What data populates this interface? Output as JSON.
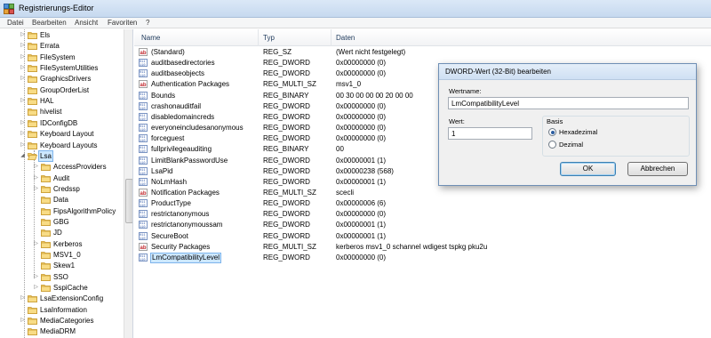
{
  "window": {
    "title": "Registrierungs-Editor"
  },
  "menu": [
    "Datei",
    "Bearbeiten",
    "Ansicht",
    "Favoriten",
    "?"
  ],
  "tree": {
    "items": [
      {
        "label": "Els",
        "depth": 0,
        "expand": "▷"
      },
      {
        "label": "Errata",
        "depth": 0,
        "expand": "▷"
      },
      {
        "label": "FileSystem",
        "depth": 0,
        "expand": "▷"
      },
      {
        "label": "FileSystemUtilities",
        "depth": 0,
        "expand": "▷"
      },
      {
        "label": "GraphicsDrivers",
        "depth": 0,
        "expand": "▷"
      },
      {
        "label": "GroupOrderList",
        "depth": 0,
        "expand": ""
      },
      {
        "label": "HAL",
        "depth": 0,
        "expand": "▷"
      },
      {
        "label": "hivelist",
        "depth": 0,
        "expand": ""
      },
      {
        "label": "IDConfigDB",
        "depth": 0,
        "expand": "▷"
      },
      {
        "label": "Keyboard Layout",
        "depth": 0,
        "expand": "▷"
      },
      {
        "label": "Keyboard Layouts",
        "depth": 0,
        "expand": "▷"
      },
      {
        "label": "Lsa",
        "depth": 0,
        "expand": "◢",
        "selected": true
      },
      {
        "label": "AccessProviders",
        "depth": 1,
        "expand": "▷"
      },
      {
        "label": "Audit",
        "depth": 1,
        "expand": "▷"
      },
      {
        "label": "Credssp",
        "depth": 1,
        "expand": "▷"
      },
      {
        "label": "Data",
        "depth": 1,
        "expand": ""
      },
      {
        "label": "FipsAlgorithmPolicy",
        "depth": 1,
        "expand": ""
      },
      {
        "label": "GBG",
        "depth": 1,
        "expand": ""
      },
      {
        "label": "JD",
        "depth": 1,
        "expand": ""
      },
      {
        "label": "Kerberos",
        "depth": 1,
        "expand": "▷"
      },
      {
        "label": "MSV1_0",
        "depth": 1,
        "expand": ""
      },
      {
        "label": "Skew1",
        "depth": 1,
        "expand": ""
      },
      {
        "label": "SSO",
        "depth": 1,
        "expand": "▷"
      },
      {
        "label": "SspiCache",
        "depth": 1,
        "expand": "▷"
      },
      {
        "label": "LsaExtensionConfig",
        "depth": 0,
        "expand": "▷"
      },
      {
        "label": "LsaInformation",
        "depth": 0,
        "expand": ""
      },
      {
        "label": "MediaCategories",
        "depth": 0,
        "expand": "▷"
      },
      {
        "label": "MediaDRM",
        "depth": 0,
        "expand": ""
      }
    ]
  },
  "list": {
    "headers": {
      "name": "Name",
      "type": "Typ",
      "data": "Daten"
    },
    "rows": [
      {
        "icon": "string-value-icon",
        "name": "(Standard)",
        "type": "REG_SZ",
        "data": "(Wert nicht festgelegt)"
      },
      {
        "icon": "binary-value-icon",
        "name": "auditbasedirectories",
        "type": "REG_DWORD",
        "data": "0x00000000 (0)"
      },
      {
        "icon": "binary-value-icon",
        "name": "auditbaseobjects",
        "type": "REG_DWORD",
        "data": "0x00000000 (0)"
      },
      {
        "icon": "string-value-icon",
        "name": "Authentication Packages",
        "type": "REG_MULTI_SZ",
        "data": "msv1_0"
      },
      {
        "icon": "binary-value-icon",
        "name": "Bounds",
        "type": "REG_BINARY",
        "data": "00 30 00 00 00 20 00 00"
      },
      {
        "icon": "binary-value-icon",
        "name": "crashonauditfail",
        "type": "REG_DWORD",
        "data": "0x00000000 (0)"
      },
      {
        "icon": "binary-value-icon",
        "name": "disabledomaincreds",
        "type": "REG_DWORD",
        "data": "0x00000000 (0)"
      },
      {
        "icon": "binary-value-icon",
        "name": "everyoneincludesanonymous",
        "type": "REG_DWORD",
        "data": "0x00000000 (0)"
      },
      {
        "icon": "binary-value-icon",
        "name": "forceguest",
        "type": "REG_DWORD",
        "data": "0x00000000 (0)"
      },
      {
        "icon": "binary-value-icon",
        "name": "fullprivilegeauditing",
        "type": "REG_BINARY",
        "data": "00"
      },
      {
        "icon": "binary-value-icon",
        "name": "LimitBlankPasswordUse",
        "type": "REG_DWORD",
        "data": "0x00000001 (1)"
      },
      {
        "icon": "binary-value-icon",
        "name": "LsaPid",
        "type": "REG_DWORD",
        "data": "0x00000238 (568)"
      },
      {
        "icon": "binary-value-icon",
        "name": "NoLmHash",
        "type": "REG_DWORD",
        "data": "0x00000001 (1)"
      },
      {
        "icon": "string-value-icon",
        "name": "Notification Packages",
        "type": "REG_MULTI_SZ",
        "data": "scecli"
      },
      {
        "icon": "binary-value-icon",
        "name": "ProductType",
        "type": "REG_DWORD",
        "data": "0x00000006 (6)"
      },
      {
        "icon": "binary-value-icon",
        "name": "restrictanonymous",
        "type": "REG_DWORD",
        "data": "0x00000000 (0)"
      },
      {
        "icon": "binary-value-icon",
        "name": "restrictanonymoussam",
        "type": "REG_DWORD",
        "data": "0x00000001 (1)"
      },
      {
        "icon": "binary-value-icon",
        "name": "SecureBoot",
        "type": "REG_DWORD",
        "data": "0x00000001 (1)"
      },
      {
        "icon": "string-value-icon",
        "name": "Security Packages",
        "type": "REG_MULTI_SZ",
        "data": "kerberos msv1_0 schannel wdigest tspkg pku2u"
      },
      {
        "icon": "binary-value-icon",
        "name": "LmCompatibilityLevel",
        "type": "REG_DWORD",
        "data": "0x00000000 (0)",
        "selected": true
      }
    ]
  },
  "dialog": {
    "title": "DWORD-Wert (32-Bit) bearbeiten",
    "name_label": "Wertname:",
    "name_value": "LmCompatibilityLevel",
    "value_label": "Wert:",
    "value_value": "1",
    "basis_label": "Basis",
    "hex_label": "Hexadezimal",
    "dec_label": "Dezimal",
    "selected_basis": "hex",
    "ok_label": "OK",
    "cancel_label": "Abbrechen"
  }
}
